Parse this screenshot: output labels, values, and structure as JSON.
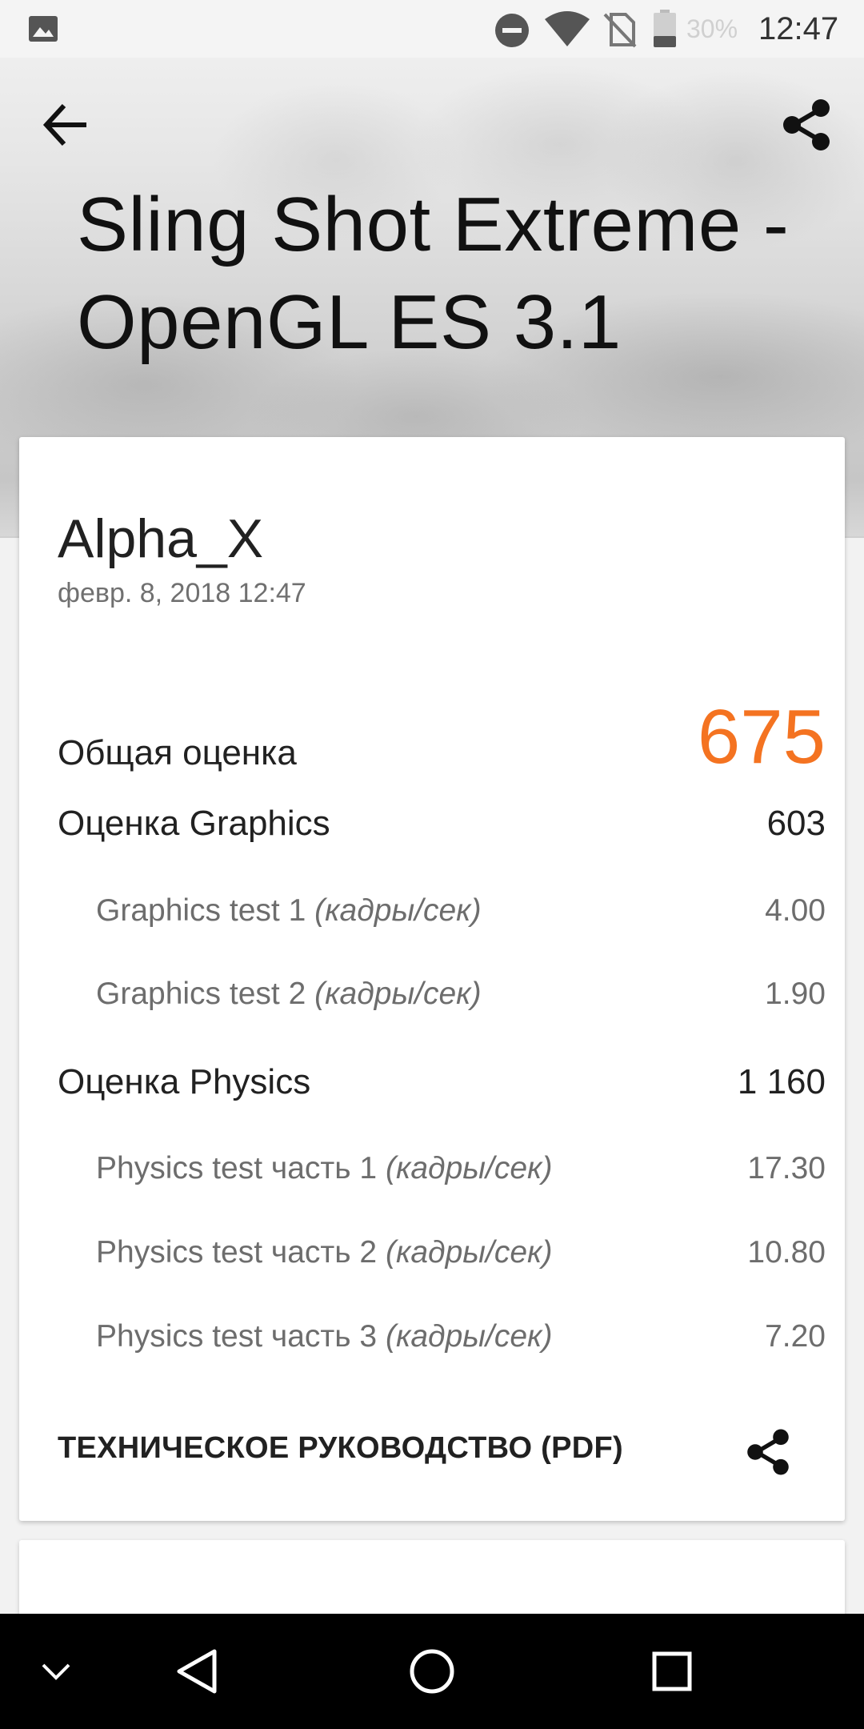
{
  "status_bar": {
    "battery_percent": "30%",
    "time": "12:47",
    "icons": [
      "image-notification-icon",
      "do-not-disturb-icon",
      "wifi-icon",
      "no-sim-icon",
      "battery-icon"
    ]
  },
  "header": {
    "title": "Sling Shot Extreme - OpenGL ES 3.1",
    "back_icon": "arrow-back-icon",
    "share_icon": "share-icon"
  },
  "result": {
    "device_name": "Alpha_X",
    "date": "февр. 8, 2018 12:47",
    "overall": {
      "label": "Общая оценка",
      "value": "675"
    },
    "graphics": {
      "label": "Оценка Graphics",
      "value": "603",
      "tests": [
        {
          "name": "Graphics test 1",
          "unit": "(кадры/сек)",
          "value": "4.00"
        },
        {
          "name": "Graphics test 2",
          "unit": "(кадры/сек)",
          "value": "1.90"
        }
      ]
    },
    "physics": {
      "label": "Оценка Physics",
      "value": "1 160",
      "tests": [
        {
          "name": "Physics test часть 1",
          "unit": "(кадры/сек)",
          "value": "17.30"
        },
        {
          "name": "Physics test часть 2",
          "unit": "(кадры/сек)",
          "value": "10.80"
        },
        {
          "name": "Physics test часть 3",
          "unit": "(кадры/сек)",
          "value": "7.20"
        }
      ]
    },
    "tech_guide_label": "ТЕХНИЧЕСКОЕ РУКОВОДСТВО (PDF)"
  },
  "colors": {
    "score_accent": "#f47321",
    "card_background": "#ffffff",
    "navbar_background": "#000000"
  },
  "navigation_bar": {
    "icons": [
      "chevron-down-icon",
      "nav-back-icon",
      "nav-home-icon",
      "nav-recents-icon"
    ]
  }
}
